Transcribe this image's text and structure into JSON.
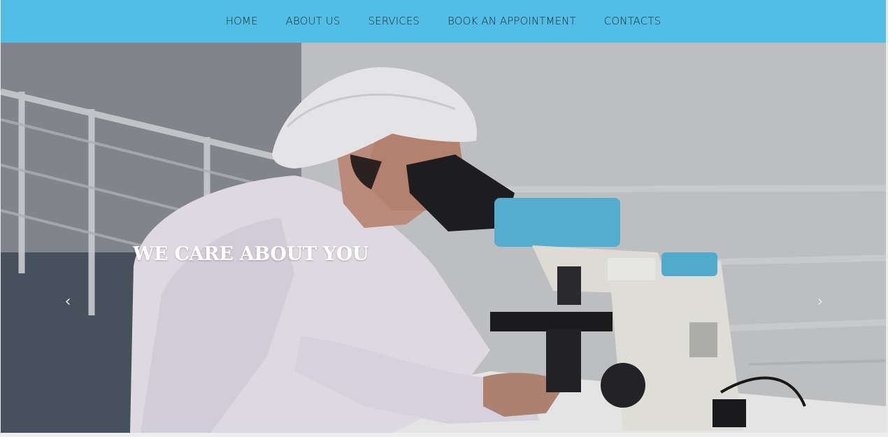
{
  "nav": {
    "items": [
      {
        "label": "HOME"
      },
      {
        "label": "ABOUT US"
      },
      {
        "label": "SERVICES"
      },
      {
        "label": "BOOK AN APPOINTMENT"
      },
      {
        "label": "CONTACTS"
      }
    ]
  },
  "hero": {
    "title": "WE CARE ABOUT YOU",
    "prev_icon": "chevron-left-icon",
    "next_icon": "chevron-right-icon"
  },
  "colors": {
    "navbar_bg": "#52bee5",
    "nav_text": "#1c2a33",
    "hero_title": "#ffffff"
  }
}
